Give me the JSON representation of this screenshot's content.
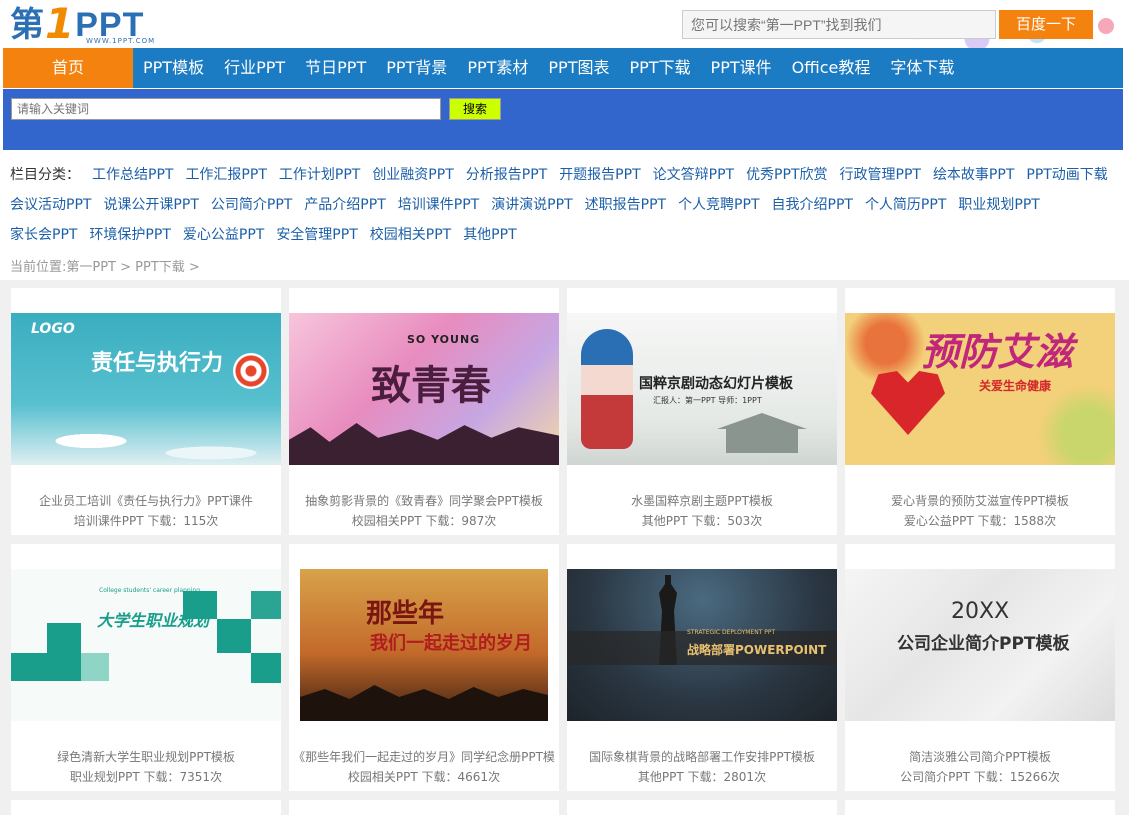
{
  "header": {
    "logo": {
      "char": "第",
      "num": "1",
      "name": "PPT",
      "sub": "WWW.1PPT.COM"
    },
    "search_placeholder": "您可以搜索“第一PPT”找到我们",
    "search_button": "百度一下"
  },
  "nav": {
    "home": "首页",
    "items": [
      "PPT模板",
      "行业PPT",
      "节日PPT",
      "PPT背景",
      "PPT素材",
      "PPT图表",
      "PPT下载",
      "PPT课件",
      "Office教程",
      "字体下载"
    ]
  },
  "keyword_search": {
    "placeholder": "请输入关键词",
    "button": "搜索"
  },
  "categories": {
    "label": "栏目分类：",
    "items": [
      "工作总结PPT",
      "工作汇报PPT",
      "工作计划PPT",
      "创业融资PPT",
      "分析报告PPT",
      "开题报告PPT",
      "论文答辩PPT",
      "优秀PPT欣赏",
      "行政管理PPT",
      "绘本故事PPT",
      "PPT动画下载",
      "会议活动PPT",
      "说课公开课PPT",
      "公司简介PPT",
      "产品介绍PPT",
      "培训课件PPT",
      "演讲演说PPT",
      "述职报告PPT",
      "个人竞聘PPT",
      "自我介绍PPT",
      "个人简历PPT",
      "职业规划PPT",
      "家长会PPT",
      "环境保护PPT",
      "爱心公益PPT",
      "安全管理PPT",
      "校园相关PPT",
      "其他PPT"
    ]
  },
  "breadcrumb": "当前位置:第一PPT > PPT下载 >",
  "cards": [
    {
      "title": "企业员工培训《责任与执行力》PPT课件",
      "meta": "培训课件PPT   下载：115次",
      "thumb_text": "责任与执行力",
      "thumb_sub": "LOGO",
      "bg": "#3aaec0"
    },
    {
      "title": "抽象剪影背景的《致青春》同学聚会PPT模板",
      "meta": "校园相关PPT   下载：987次",
      "thumb_text": "致青春",
      "thumb_sub": "SO YOUNG",
      "bg": "#e8a6c8"
    },
    {
      "title": "水墨国粹京剧主题PPT模板",
      "meta": "其他PPT   下载：503次",
      "thumb_text": "国粹京剧动态幻灯片模板",
      "thumb_sub": "汇报人：第一PPT   导师：1PPT",
      "bg": "#eef0ee"
    },
    {
      "title": "爱心背景的预防艾滋宣传PPT模板",
      "meta": "爱心公益PPT   下载：1588次",
      "thumb_text": "预防艾滋",
      "thumb_sub": "关爱生命健康",
      "bg": "#f1c75e"
    },
    {
      "title": "绿色清新大学生职业规划PPT模板",
      "meta": "职业规划PPT   下载：7351次",
      "thumb_text": "大学生职业规划",
      "thumb_sub": "College students' career planning",
      "bg": "#f4faf8"
    },
    {
      "title": "《那些年我们一起走过的岁月》同学纪念册PPT模",
      "meta": "校园相关PPT   下载：4661次",
      "thumb_text": "那些年",
      "thumb_sub": "我们一起走过的岁月",
      "bg": "#c8792a"
    },
    {
      "title": "国际象棋背景的战略部署工作安排PPT模板",
      "meta": "其他PPT   下载：2801次",
      "thumb_text": "战略部署POWERPOINT",
      "thumb_sub": "STRATEGIC DEPLOYMENT PPT",
      "bg": "#2f3a45"
    },
    {
      "title": "简洁淡雅公司简介PPT模板",
      "meta": "公司简介PPT   下载：15266次",
      "thumb_text": "公司企业简介PPT模板",
      "thumb_sub": "20XX",
      "bg": "#eeeeee"
    }
  ]
}
